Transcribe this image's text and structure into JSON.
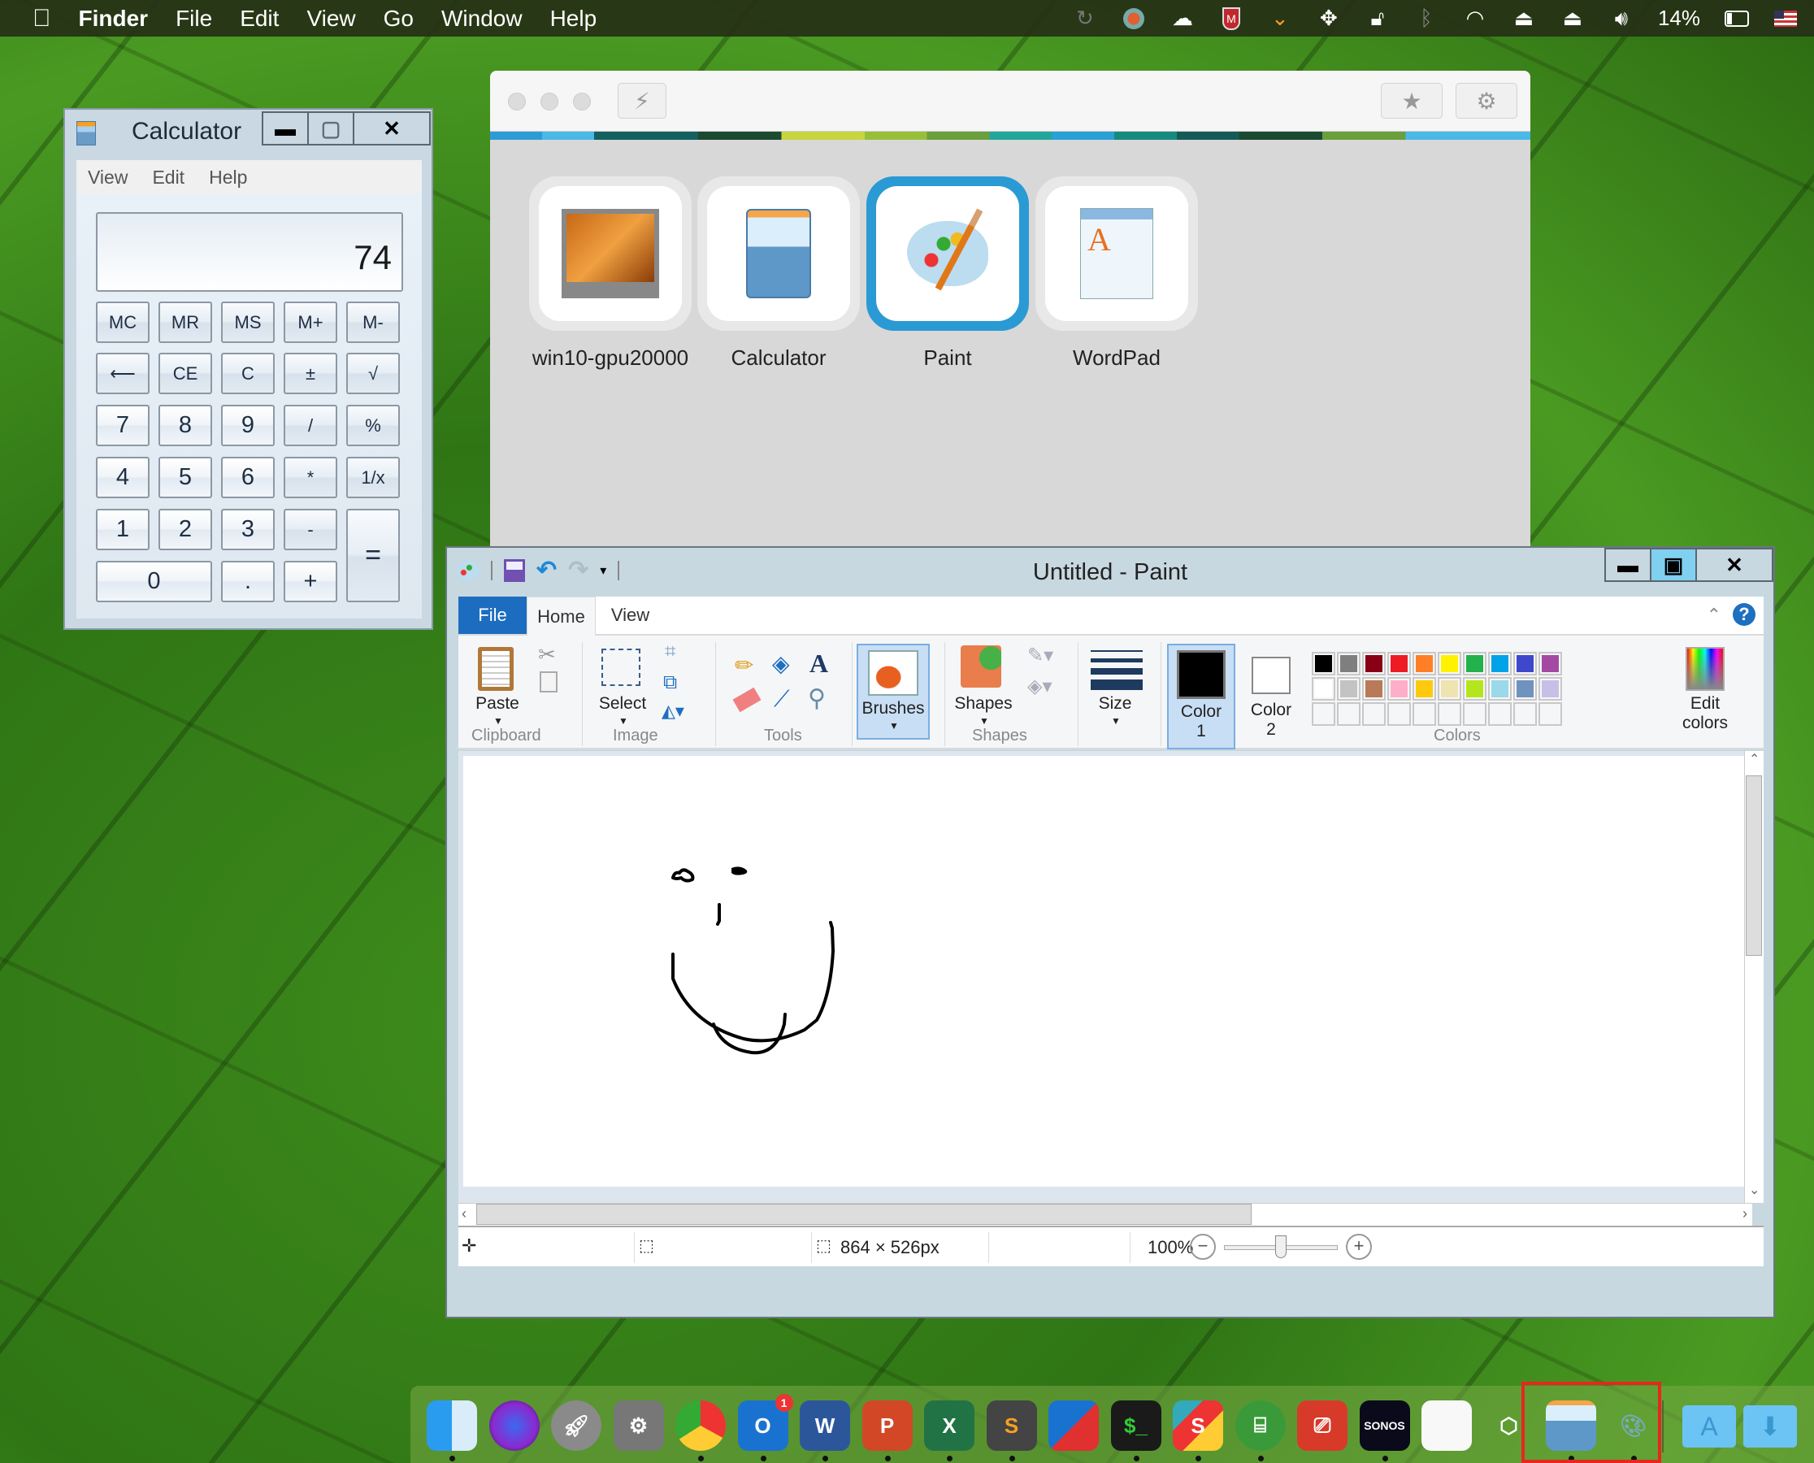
{
  "menubar": {
    "app_name": "Finder",
    "items": [
      "File",
      "Edit",
      "View",
      "Go",
      "Window",
      "Help"
    ],
    "battery_percent": "14%",
    "status_icons": [
      "time-machine-icon",
      "crossover-icon",
      "creative-cloud-icon",
      "mcafee-icon",
      "ubar-icon",
      "resize-icon",
      "lock-icon",
      "bluetooth-icon",
      "wifi-icon",
      "airplay-icon",
      "eject-icon",
      "volume-icon",
      "battery-icon",
      "us-flag-icon"
    ]
  },
  "calculator": {
    "title": "Calculator",
    "menu": [
      "View",
      "Edit",
      "Help"
    ],
    "display": "74",
    "buttons": {
      "row1": [
        "MC",
        "MR",
        "MS",
        "M+",
        "M-"
      ],
      "row2": [
        "⟵",
        "CE",
        "C",
        "±",
        "√"
      ],
      "row3": [
        "7",
        "8",
        "9",
        "/",
        "%"
      ],
      "row4": [
        "4",
        "5",
        "6",
        "*",
        "1/x"
      ],
      "row5": [
        "1",
        "2",
        "3",
        "-"
      ],
      "row6": [
        "0",
        ".",
        "+"
      ],
      "equals": "="
    }
  },
  "launcher": {
    "apps": [
      {
        "label": "win10-gpu20000",
        "icon": "monitor-icon",
        "selected": false
      },
      {
        "label": "Calculator",
        "icon": "calculator-icon",
        "selected": false
      },
      {
        "label": "Paint",
        "icon": "paint-palette-icon",
        "selected": true
      },
      {
        "label": "WordPad",
        "icon": "wordpad-icon",
        "selected": false
      }
    ],
    "selection_color": "#2a9ad4"
  },
  "paint": {
    "title": "Untitled - Paint",
    "tabs": {
      "file": "File",
      "home": "Home",
      "view": "View"
    },
    "clipboard": {
      "paste": "Paste",
      "group": "Clipboard"
    },
    "image": {
      "select": "Select",
      "group": "Image"
    },
    "tools": {
      "group": "Tools"
    },
    "brushes": {
      "label": "Brushes"
    },
    "shapes": {
      "label": "Shapes",
      "group": "Shapes"
    },
    "size": {
      "label": "Size"
    },
    "color1": {
      "label": "Color",
      "num": "1",
      "value": "#000000"
    },
    "color2": {
      "label": "Color",
      "num": "2",
      "value": "#ffffff"
    },
    "colors_group": "Colors",
    "edit_colors": {
      "l1": "Edit",
      "l2": "colors"
    },
    "palette_row1": [
      "#000000",
      "#7f7f7f",
      "#880015",
      "#ed1c24",
      "#ff7f27",
      "#fff200",
      "#22b14c",
      "#00a2e8",
      "#3f48cc",
      "#a349a4"
    ],
    "palette_row2": [
      "#ffffff",
      "#c3c3c3",
      "#b97a57",
      "#ffaec9",
      "#ffc90e",
      "#efe4b0",
      "#b5e61d",
      "#99d9ea",
      "#7092be",
      "#c8bfe7"
    ],
    "status": {
      "canvas_size": "864 × 526px",
      "zoom": "100%",
      "zoom_level_fraction": 0.5
    }
  },
  "dock": {
    "apps": [
      "Finder",
      "Siri",
      "Launchpad",
      "System Preferences",
      "Chrome",
      "Outlook",
      "Word",
      "PowerPoint",
      "Excel",
      "Sublime Text",
      "VMware Horizon",
      "Terminal",
      "Slack",
      "Keynote Remote",
      "Remote Desktop",
      "Sonos",
      "TextEdit",
      "Unity",
      "Calculator",
      "Paint"
    ],
    "outlook_badge": "1",
    "sonos_label": "SONOS",
    "terminal_label": "$_",
    "highlight_color": "#e8261e"
  }
}
